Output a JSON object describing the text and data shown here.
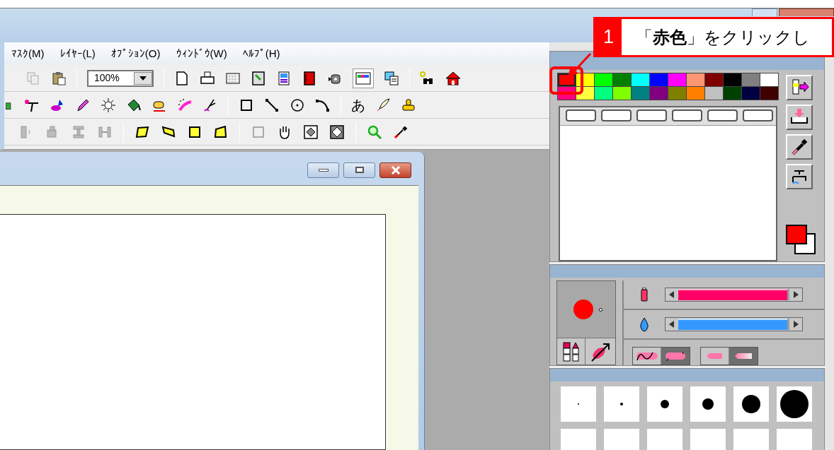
{
  "menu": [
    {
      "label": "ﾏｽｸ(M)"
    },
    {
      "label": "ﾚｲﾔｰ(L)"
    },
    {
      "label": "ｵﾌﾟｼｮﾝ(O)"
    },
    {
      "label": "ｳｨﾝﾄﾞｳ(W)"
    },
    {
      "label": "ﾍﾙﾌﾟ(H)"
    }
  ],
  "toolbar": {
    "zoom": "100%",
    "text_tool": "あ"
  },
  "callout": {
    "step": "1",
    "text": "「**赤色**」をクリックし"
  },
  "palette": {
    "swatches": [
      {
        "color": "#ff0000",
        "selected": true
      },
      {
        "color": "#ffff00",
        "selected": false
      },
      {
        "color": "#00ff00",
        "selected": false
      },
      {
        "color": "#008000",
        "selected": false
      },
      {
        "color": "#00ffff",
        "selected": false
      },
      {
        "color": "#0000ff",
        "selected": false
      },
      {
        "color": "#ff00ff",
        "selected": false
      },
      {
        "color": "#ff9673",
        "selected": false
      },
      {
        "color": "#800000",
        "selected": false
      },
      {
        "color": "#000000",
        "selected": false
      },
      {
        "color": "#808080",
        "selected": false
      },
      {
        "color": "#ffffff",
        "selected": false
      },
      {
        "color": "#ff0080",
        "selected": false
      },
      {
        "color": "#ffff40",
        "selected": false
      },
      {
        "color": "#00ff80",
        "selected": false
      },
      {
        "color": "#80ff00",
        "selected": false
      },
      {
        "color": "#008080",
        "selected": false
      },
      {
        "color": "#800080",
        "selected": false
      },
      {
        "color": "#808000",
        "selected": false
      },
      {
        "color": "#ff8000",
        "selected": false
      },
      {
        "color": "#c0c0c0",
        "selected": false
      },
      {
        "color": "#004000",
        "selected": false
      },
      {
        "color": "#000040",
        "selected": false
      },
      {
        "color": "#400000",
        "selected": false
      }
    ]
  },
  "brush": {
    "sliders": [
      {
        "kind": "density",
        "level": 0.98
      },
      {
        "kind": "water",
        "level": 0.98
      }
    ],
    "stroke_modes": [
      {
        "selected": false
      },
      {
        "selected": true
      }
    ],
    "edge_modes": [
      {
        "selected": false
      },
      {
        "selected": true
      }
    ]
  }
}
